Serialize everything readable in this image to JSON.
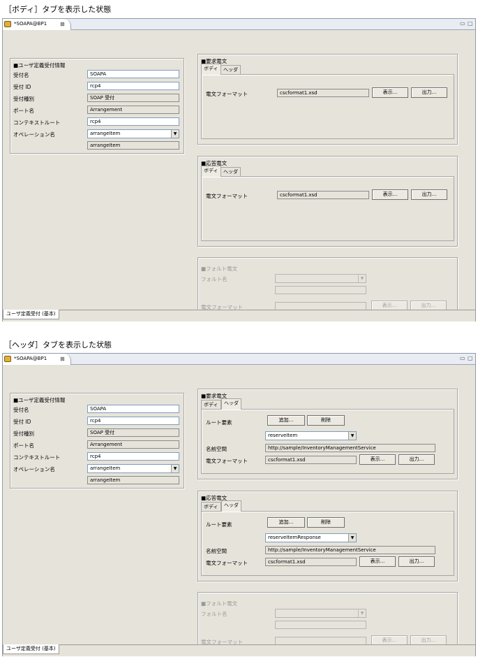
{
  "captions": [
    "［ボディ］タブを表示した状態",
    "［ヘッダ］タブを表示した状態"
  ],
  "editor_tab": {
    "title": "*SOAPA@BP1",
    "close": "⊠"
  },
  "window_controls": {
    "minimize": "▭",
    "maximize": "▢"
  },
  "bottom_tab": "ユーザ定義受付 (基本)",
  "user_info": {
    "title": "■ユーザ定義受付情報",
    "labels": [
      "受付名",
      "受付 ID",
      "受付種別",
      "ポート名",
      "コンテキストルート",
      "オペレーション名"
    ],
    "values": {
      "name": "SOAPA",
      "id": "rcp4",
      "type": "SOAP 受付",
      "port": "Arrangement",
      "context_root": "rcp4",
      "operation": "arrangeItem",
      "operation_sub": "arrangeItem"
    }
  },
  "tabs": {
    "body": "ボディ",
    "header": "ヘッダ"
  },
  "request": {
    "title": "■要求電文"
  },
  "response": {
    "title": "■応答電文"
  },
  "fault": {
    "title": "■フォルト電文",
    "fault_name_label": "フォルト名",
    "format_label": "電文フォーマット"
  },
  "body_tab": {
    "format_label": "電文フォーマット",
    "format_value": "cscformat1.xsd",
    "show_button": "表示...",
    "output_button": "出力..."
  },
  "header_tab": {
    "root_label": "ルート要素",
    "add_button": "追加...",
    "delete_button": "削除",
    "namespace_label": "名前空間",
    "namespace_value": "http://sample/InventoryManagementService",
    "format_label": "電文フォーマット",
    "format_value": "cscformat1.xsd",
    "show_button": "表示...",
    "output_button": "出力...",
    "request_root": "reserveItem",
    "response_root": "reserveItemResponse"
  }
}
